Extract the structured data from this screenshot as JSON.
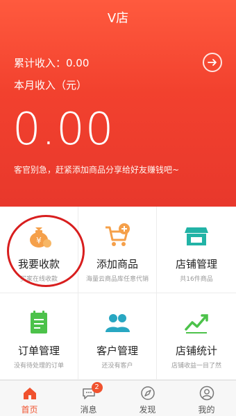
{
  "header": {
    "title": "V店",
    "total_income": "累计收入：0.00",
    "month_income": "本月收入（元）",
    "amount": "0.00",
    "promo": "客官别急，赶紧添加商品分享给好友赚钱吧~"
  },
  "grid": [
    {
      "label": "我要收款",
      "sub": "买家在线收款",
      "icon": "money-bag-icon",
      "color": "#f5a04a"
    },
    {
      "label": "添加商品",
      "sub": "海量云商品库任意代销",
      "icon": "cart-plus-icon",
      "color": "#f5a04a"
    },
    {
      "label": "店铺管理",
      "sub": "共16件商品",
      "icon": "store-icon",
      "color": "#22b3a6"
    },
    {
      "label": "订单管理",
      "sub": "没有待处理的订单",
      "icon": "order-list-icon",
      "color": "#4cc24a"
    },
    {
      "label": "客户管理",
      "sub": "还没有客户",
      "icon": "customers-icon",
      "color": "#28a7c2"
    },
    {
      "label": "店铺统计",
      "sub": "店铺收益一目了然",
      "icon": "stats-icon",
      "color": "#4cc24a"
    }
  ],
  "tabs": [
    {
      "label": "首页",
      "icon": "home-icon",
      "active": true
    },
    {
      "label": "消息",
      "icon": "message-icon",
      "badge": "2"
    },
    {
      "label": "发现",
      "icon": "compass-icon"
    },
    {
      "label": "我的",
      "icon": "user-icon"
    }
  ],
  "colors": {
    "accent": "#f0522e",
    "header_top": "#ff5a3e",
    "header_bottom": "#e8382c"
  }
}
